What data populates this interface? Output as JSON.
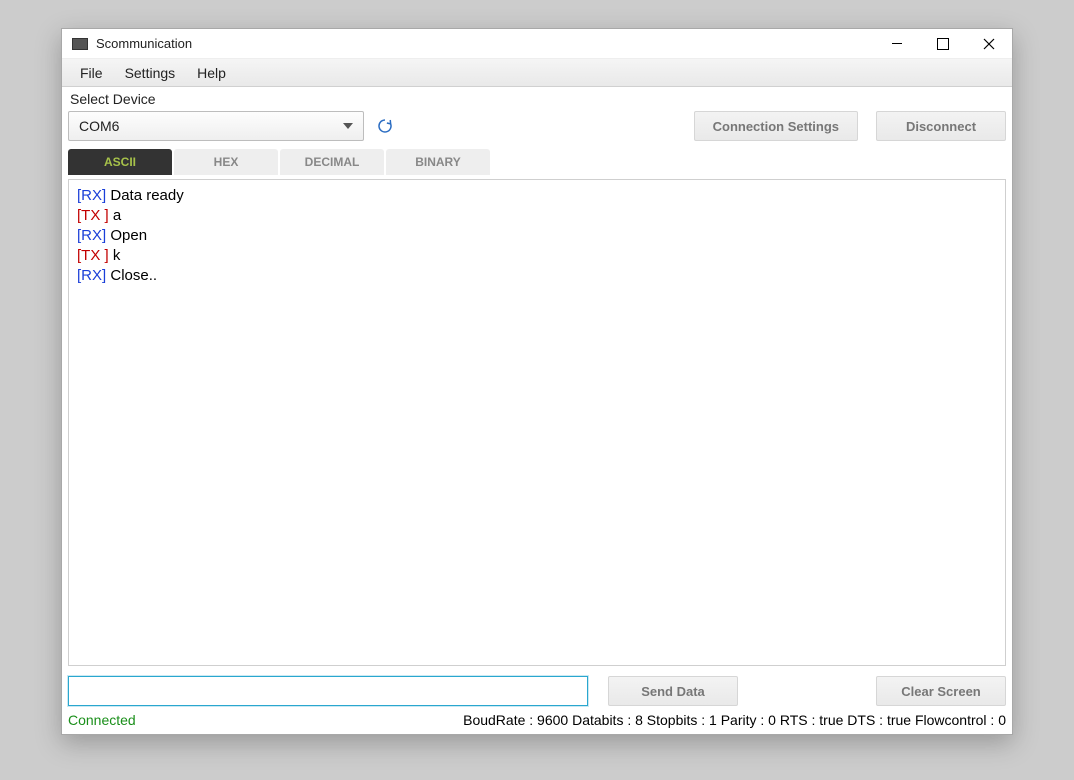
{
  "window": {
    "title": "Scommunication"
  },
  "menubar": {
    "items": [
      "File",
      "Settings",
      "Help"
    ]
  },
  "device": {
    "label": "Select Device",
    "selected": "COM6"
  },
  "buttons": {
    "connection_settings": "Connection Settings",
    "disconnect": "Disconnect",
    "send_data": "Send Data",
    "clear_screen": "Clear Screen"
  },
  "tabs": {
    "items": [
      "ASCII",
      "HEX",
      "DECIMAL",
      "BINARY"
    ],
    "active_index": 0
  },
  "terminal": {
    "lines": [
      {
        "tag": "[RX]",
        "type": "rx",
        "text": " Data ready"
      },
      {
        "tag": "[TX ]",
        "type": "tx",
        "text": " a"
      },
      {
        "tag": "[RX]",
        "type": "rx",
        "text": " Open"
      },
      {
        "tag": "[TX ]",
        "type": "tx",
        "text": " k"
      },
      {
        "tag": "[RX]",
        "type": "rx",
        "text": " Close.."
      }
    ]
  },
  "input": {
    "value": ""
  },
  "status": {
    "connected": "Connected",
    "info": "BoudRate : 9600 Databits : 8 Stopbits : 1 Parity : 0 RTS : true DTS : true Flowcontrol : 0"
  }
}
